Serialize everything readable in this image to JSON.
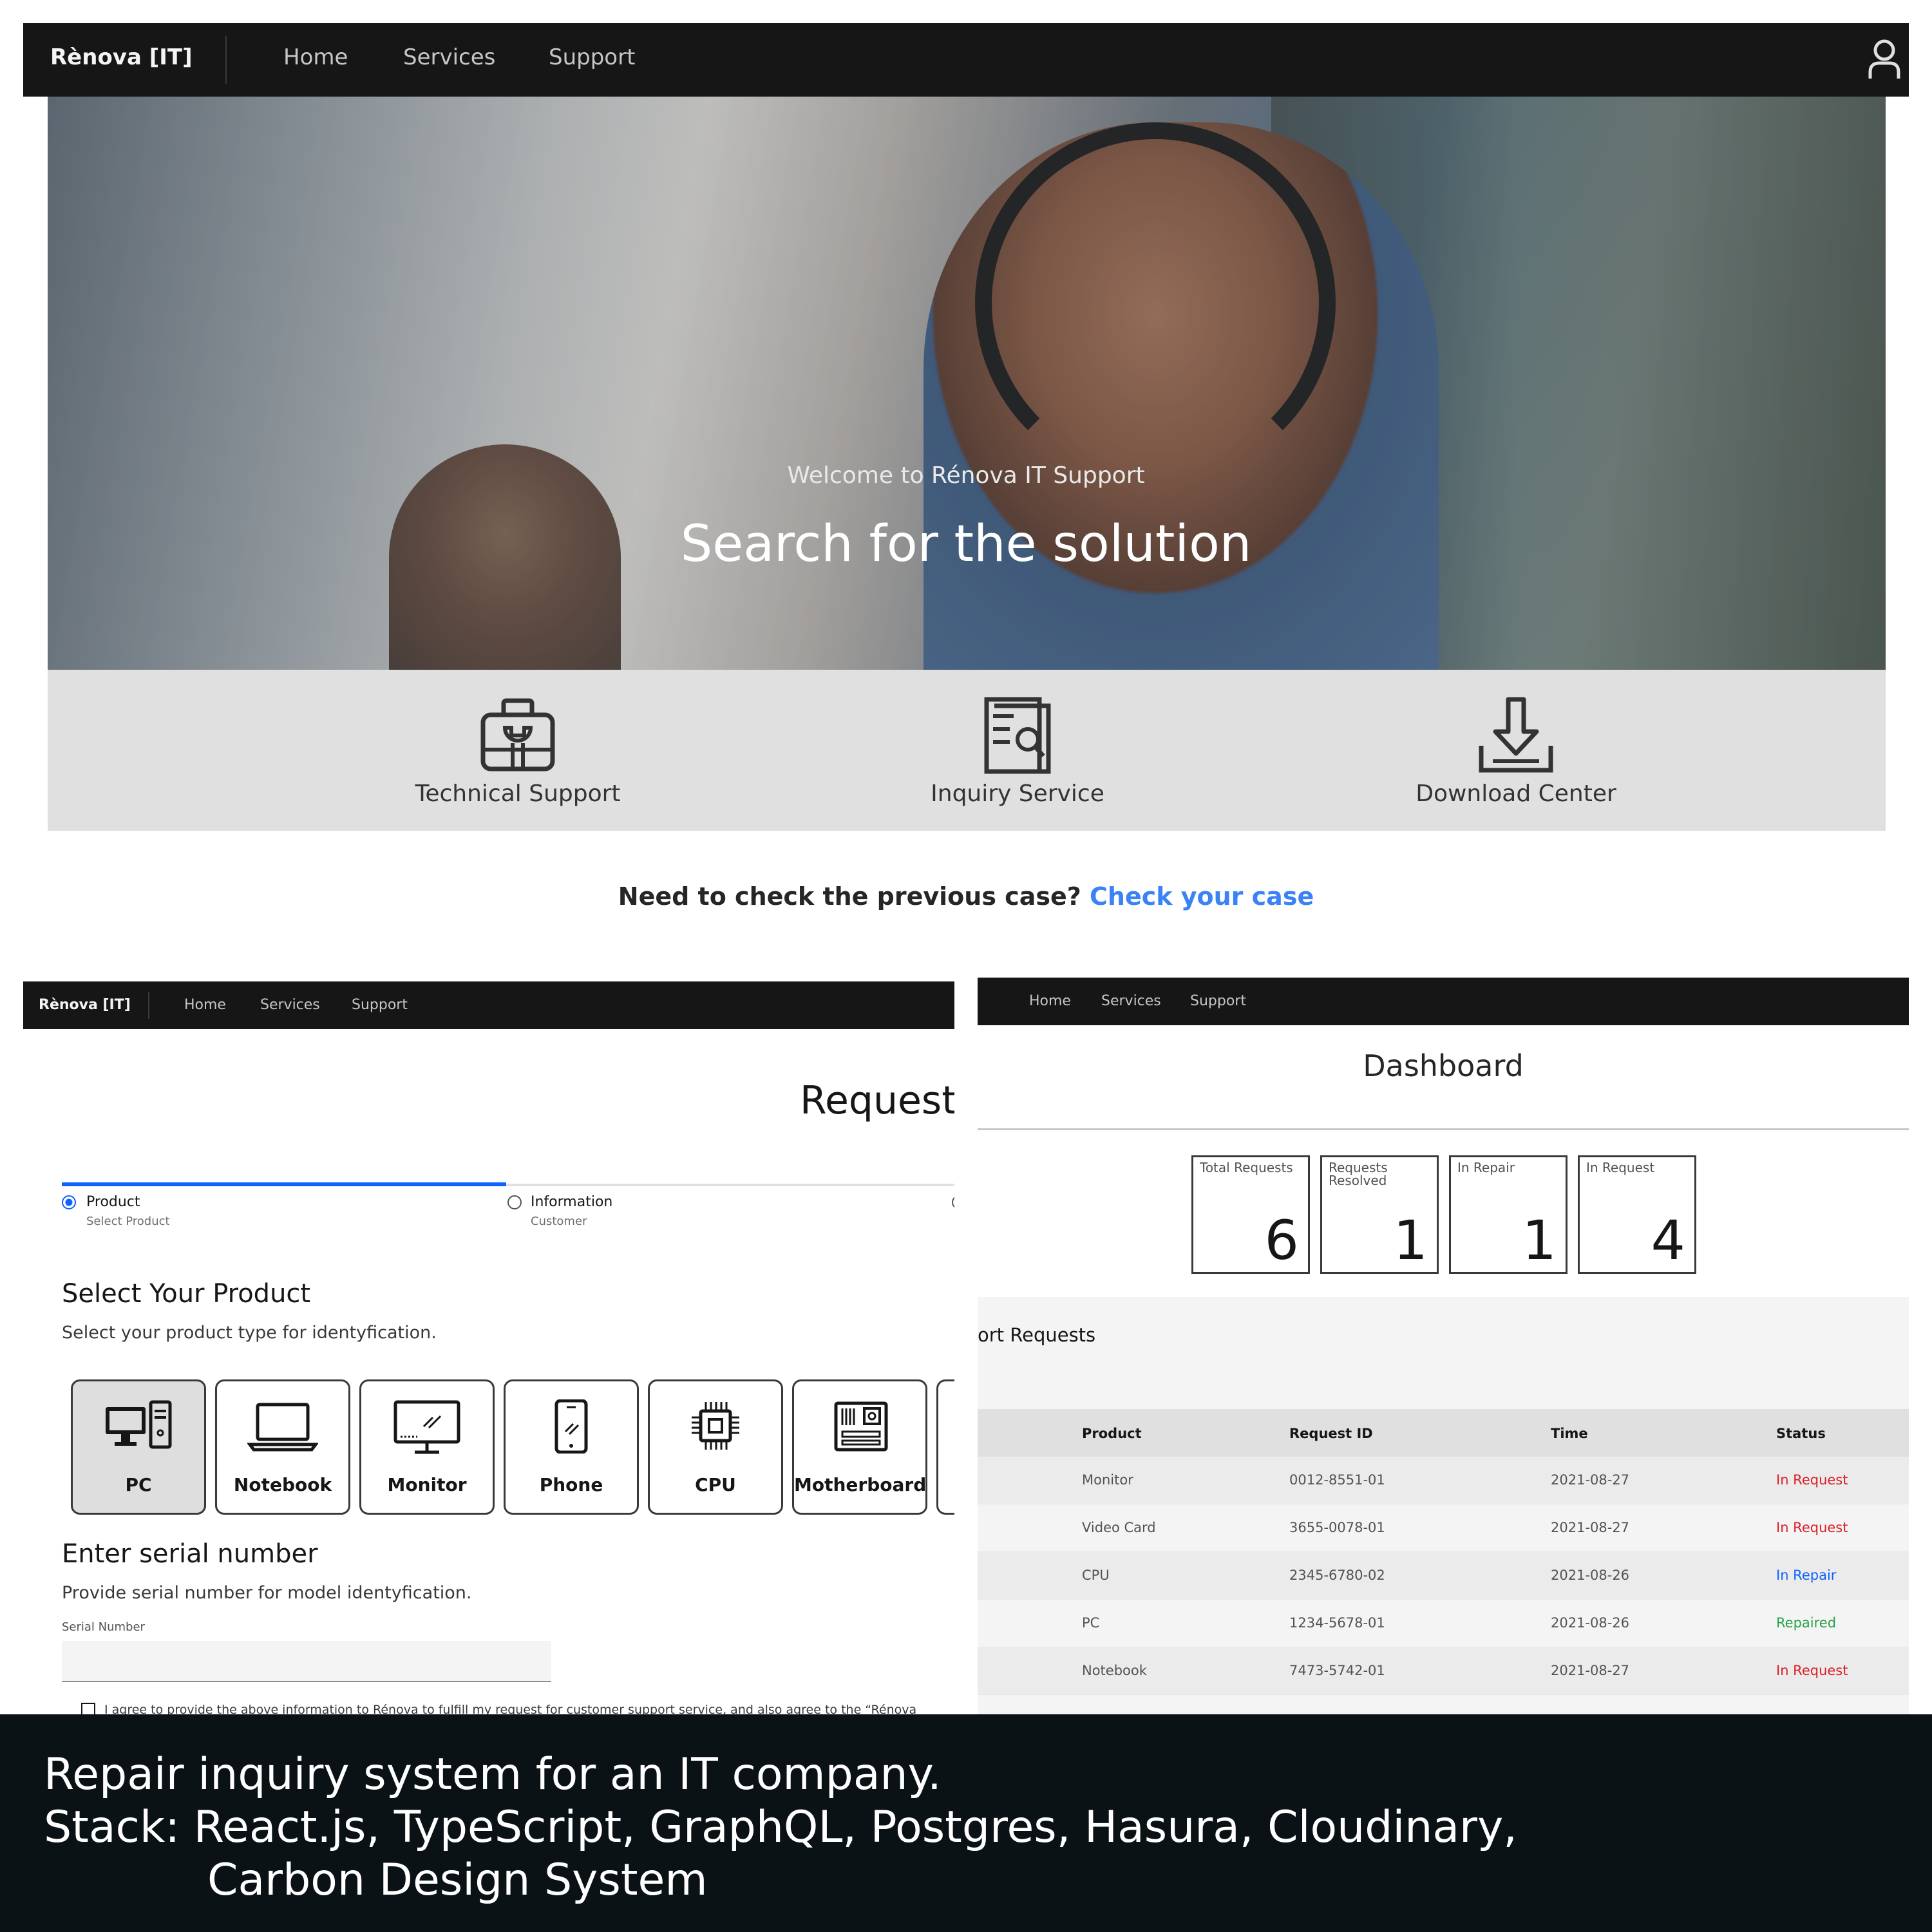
{
  "top": {
    "nav": {
      "brand": "Rènova [IT]",
      "links": [
        "Home",
        "Services",
        "Support"
      ],
      "user_icon": "user-icon"
    },
    "hero": {
      "subtitle": "Welcome to Rénova IT Support",
      "title": "Search for the solution"
    },
    "services": [
      {
        "label": "Technical Support",
        "icon": "toolbox-icon"
      },
      {
        "label": "Inquiry Service",
        "icon": "document-search-icon"
      },
      {
        "label": "Download Center",
        "icon": "download-icon"
      }
    ],
    "check_case": {
      "prompt": "Need to check the previous case? ",
      "link": "Check your case",
      "link_color": "#3b82f6"
    }
  },
  "request": {
    "nav": {
      "brand": "Rènova [IT]",
      "links": [
        "Home",
        "Services",
        "Support"
      ]
    },
    "title": "Request",
    "steps": [
      {
        "label": "Product",
        "sub": "Select Product",
        "state": "current"
      },
      {
        "label": "Information",
        "sub": "Customer",
        "state": "incomplete"
      }
    ],
    "select_heading": "Select Your Product",
    "select_desc": "Select your product type for identyfication.",
    "products": [
      {
        "label": "PC",
        "icon": "desktop-pc-icon",
        "selected": true
      },
      {
        "label": "Notebook",
        "icon": "laptop-icon"
      },
      {
        "label": "Monitor",
        "icon": "monitor-icon"
      },
      {
        "label": "Phone",
        "icon": "phone-icon"
      },
      {
        "label": "CPU",
        "icon": "cpu-chip-icon"
      },
      {
        "label": "Motherboard",
        "icon": "motherboard-icon"
      }
    ],
    "serial_heading": "Enter serial number",
    "serial_desc": "Provide serial number for model identyfication.",
    "serial_label": "Serial Number",
    "serial_value": "",
    "agree_text": "I agree to provide the above information to Rénova to fulfill my request for customer support service, and also agree to the “Rénova"
  },
  "dashboard": {
    "nav": {
      "links": [
        "Home",
        "Services",
        "Support"
      ]
    },
    "title": "Dashboard",
    "tiles": [
      {
        "label": "Total Requests",
        "value": "6"
      },
      {
        "label": "Requests Resolved",
        "value": "1"
      },
      {
        "label": "In Repair",
        "value": "1"
      },
      {
        "label": "In Request",
        "value": "4"
      }
    ],
    "table": {
      "title": "ort Requests",
      "headers": [
        "Product",
        "Request ID",
        "Time",
        "Status"
      ],
      "rows": [
        {
          "product": "Monitor",
          "id": "0012-8551-01",
          "time": "2021-08-27",
          "status": "In Request"
        },
        {
          "product": "Video Card",
          "id": "3655-0078-01",
          "time": "2021-08-27",
          "status": "In Request"
        },
        {
          "product": "CPU",
          "id": "2345-6780-02",
          "time": "2021-08-26",
          "status": "In Repair"
        },
        {
          "product": "PC",
          "id": "1234-5678-01",
          "time": "2021-08-26",
          "status": "Repaired"
        },
        {
          "product": "Notebook",
          "id": "7473-5742-01",
          "time": "2021-08-27",
          "status": "In Request"
        }
      ],
      "status_colors": {
        "In Request": "#da1e28",
        "In Repair": "#0f62fe",
        "Repaired": "#24a148"
      }
    }
  },
  "caption": {
    "line1": "Repair inquiry system for an IT company.",
    "line2": "Stack: React.js, TypeScript, GraphQL, Postgres, Hasura, Cloudinary,",
    "line3": "Carbon Design System"
  }
}
